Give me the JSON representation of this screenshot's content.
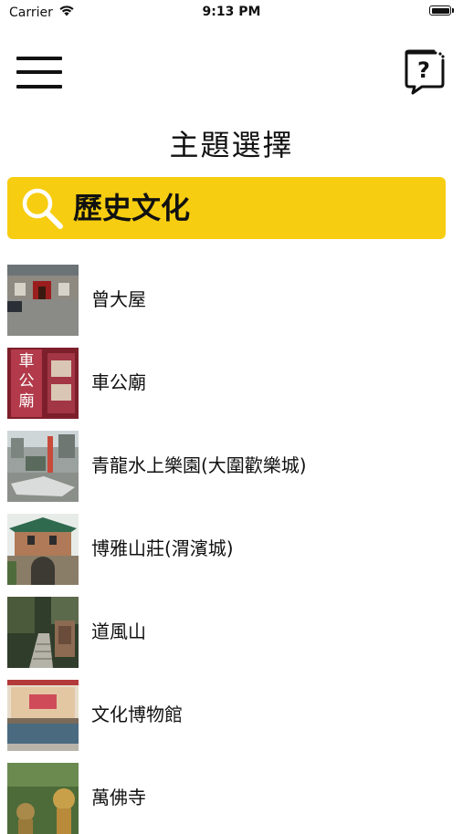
{
  "status_bar": {
    "carrier": "Carrier",
    "time": "9:13 PM",
    "wifi_icon": "wifi-icon",
    "battery_icon": "battery-icon"
  },
  "header": {
    "menu_icon": "hamburger-menu-icon",
    "help_icon": "help-chat-bubble-icon",
    "title": "主題選擇"
  },
  "search": {
    "icon": "search-icon",
    "value": "歷史文化",
    "background_color": "#f6cd10"
  },
  "places": [
    {
      "label": "曾大屋"
    },
    {
      "label": "車公廟",
      "thumbnail_text": [
        "車",
        "公",
        "廟"
      ]
    },
    {
      "label": "青龍水上樂園(大圍歡樂城)"
    },
    {
      "label": "博雅山莊(渭濱城)"
    },
    {
      "label": "道風山"
    },
    {
      "label": "文化博物館"
    },
    {
      "label": "萬佛寺"
    }
  ]
}
